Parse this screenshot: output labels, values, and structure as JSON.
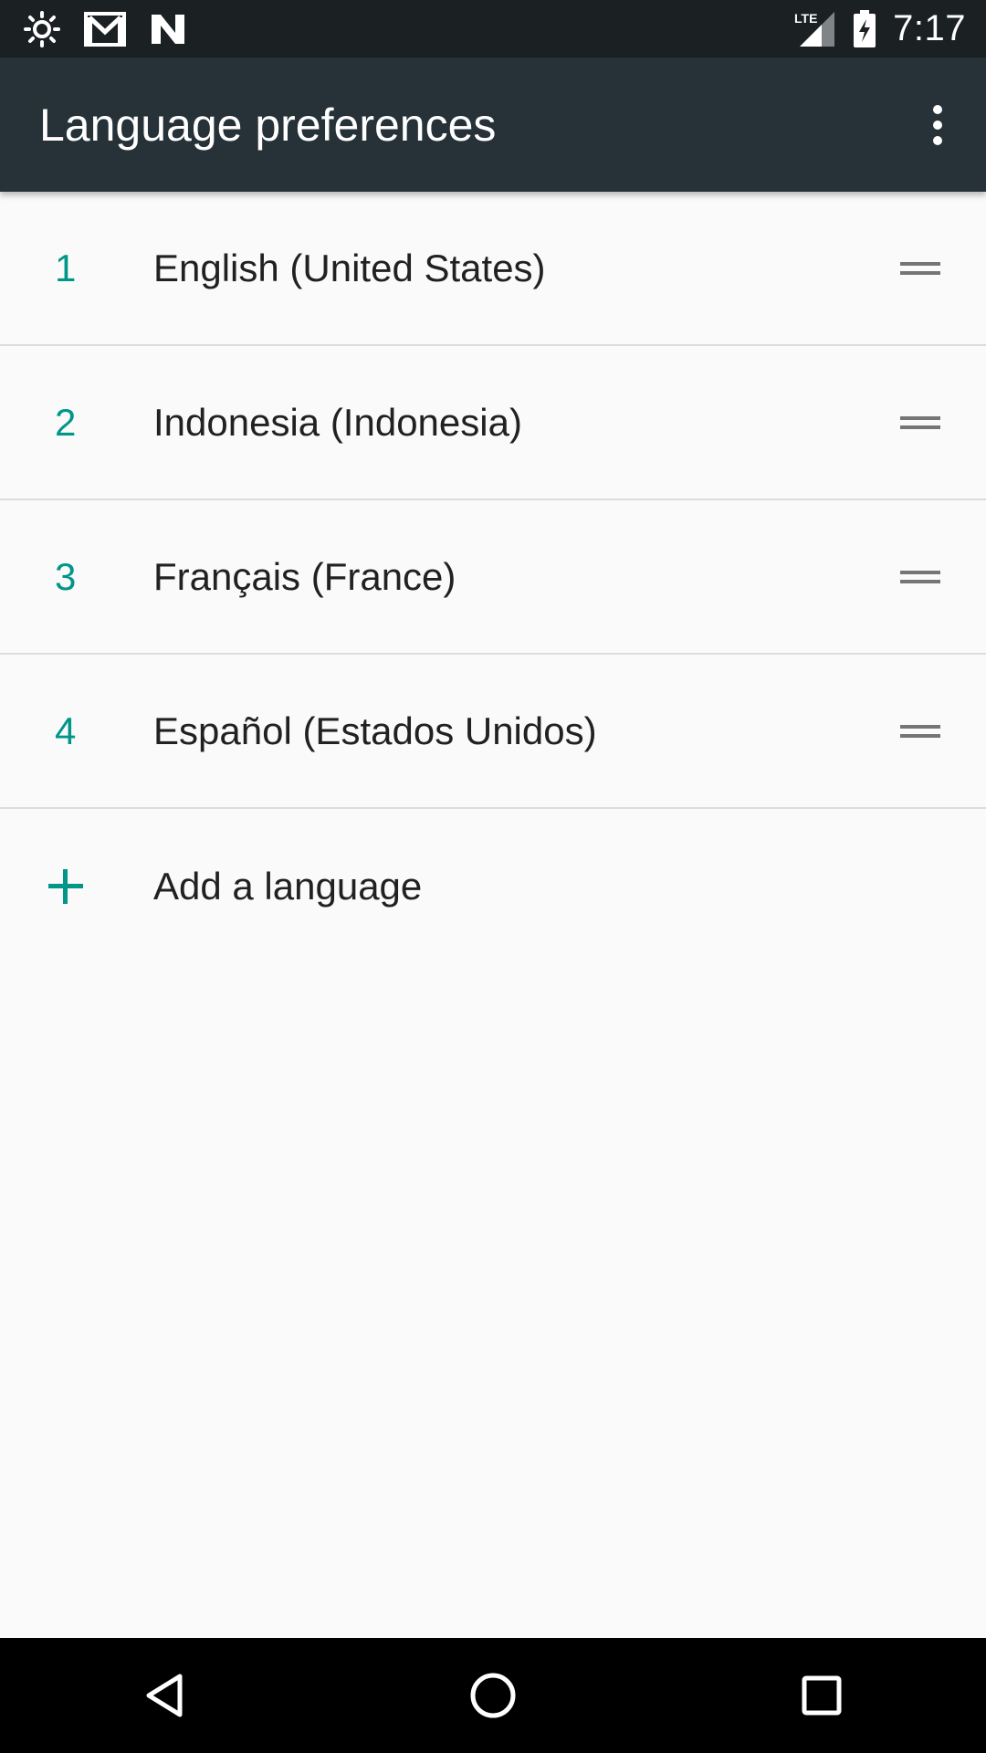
{
  "status_bar": {
    "time": "7:17",
    "network": "LTE",
    "icons": [
      "brightness-icon",
      "gmail-icon",
      "n-icon",
      "lte-signal-icon",
      "battery-charging-icon"
    ]
  },
  "app_bar": {
    "title": "Language preferences",
    "menu_icon": "more-vert-icon"
  },
  "languages": [
    {
      "index": "1",
      "label": "English (United States)"
    },
    {
      "index": "2",
      "label": "Indonesia (Indonesia)"
    },
    {
      "index": "3",
      "label": "Français (France)"
    },
    {
      "index": "4",
      "label": "Español (Estados Unidos)"
    }
  ],
  "add_language": {
    "label": "Add a language",
    "icon": "plus-icon"
  },
  "nav_bar": {
    "buttons": [
      "back-icon",
      "home-icon",
      "recents-icon"
    ]
  },
  "colors": {
    "app_bar": "#263238",
    "status_bar": "#1b2023",
    "accent": "#009688",
    "background": "#fafafa"
  }
}
